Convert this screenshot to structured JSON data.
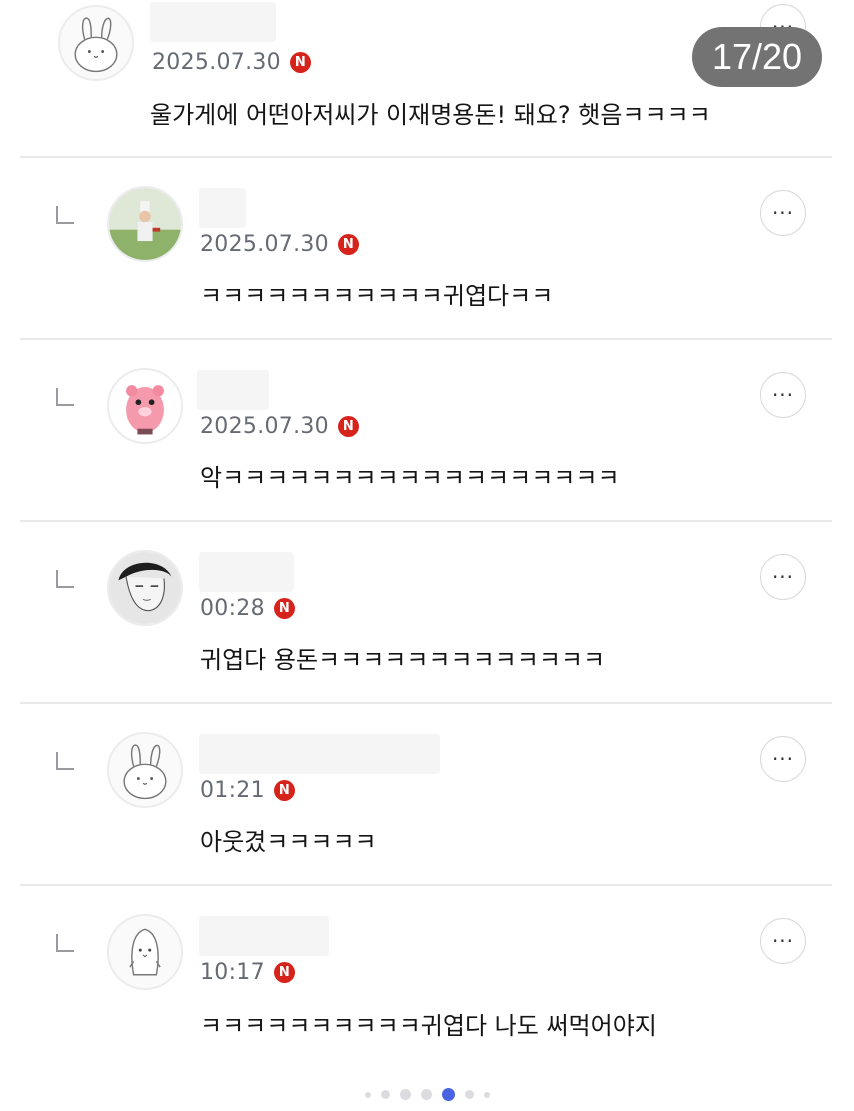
{
  "slide_counter": "17/20",
  "comments": [
    {
      "time": "2025.07.30",
      "badge": "N",
      "text": "울가게에 어떤아저씨가 이재명용돈! 돼요? 햇음ㅋㅋㅋㅋ",
      "avatar": "rabbit-doodle-avatar"
    },
    {
      "time": "2025.07.30",
      "badge": "N",
      "text": "ㅋㅋㅋㅋㅋㅋㅋㅋㅋㅋㅋ귀엽다ㅋㅋ",
      "avatar": "photo-person-avatar"
    },
    {
      "time": "2025.07.30",
      "badge": "N",
      "text": "악ㅋㅋㅋㅋㅋㅋㅋㅋㅋㅋㅋㅋㅋㅋㅋㅋㅋㅋ",
      "avatar": "pink-beaver-avatar"
    },
    {
      "time": "00:28",
      "badge": "N",
      "text": "귀엽다 용돈ㅋㅋㅋㅋㅋㅋㅋㅋㅋㅋㅋㅋㅋ",
      "avatar": "manga-man-avatar"
    },
    {
      "time": "01:21",
      "badge": "N",
      "text": "아웃겼ㅋㅋㅋㅋㅋ",
      "avatar": "rabbit-doodle-avatar"
    },
    {
      "time": "10:17",
      "badge": "N",
      "text": "ㅋㅋㅋㅋㅋㅋㅋㅋㅋㅋ귀엽다 나도 써먹어야지",
      "avatar": "penguin-avatar"
    }
  ],
  "more_label": "···",
  "colors": {
    "badge": "#d6241c",
    "counter_bg": "#737373",
    "active_dot": "#4a63e0"
  },
  "pagination": {
    "total": 7,
    "active_index": 4
  }
}
